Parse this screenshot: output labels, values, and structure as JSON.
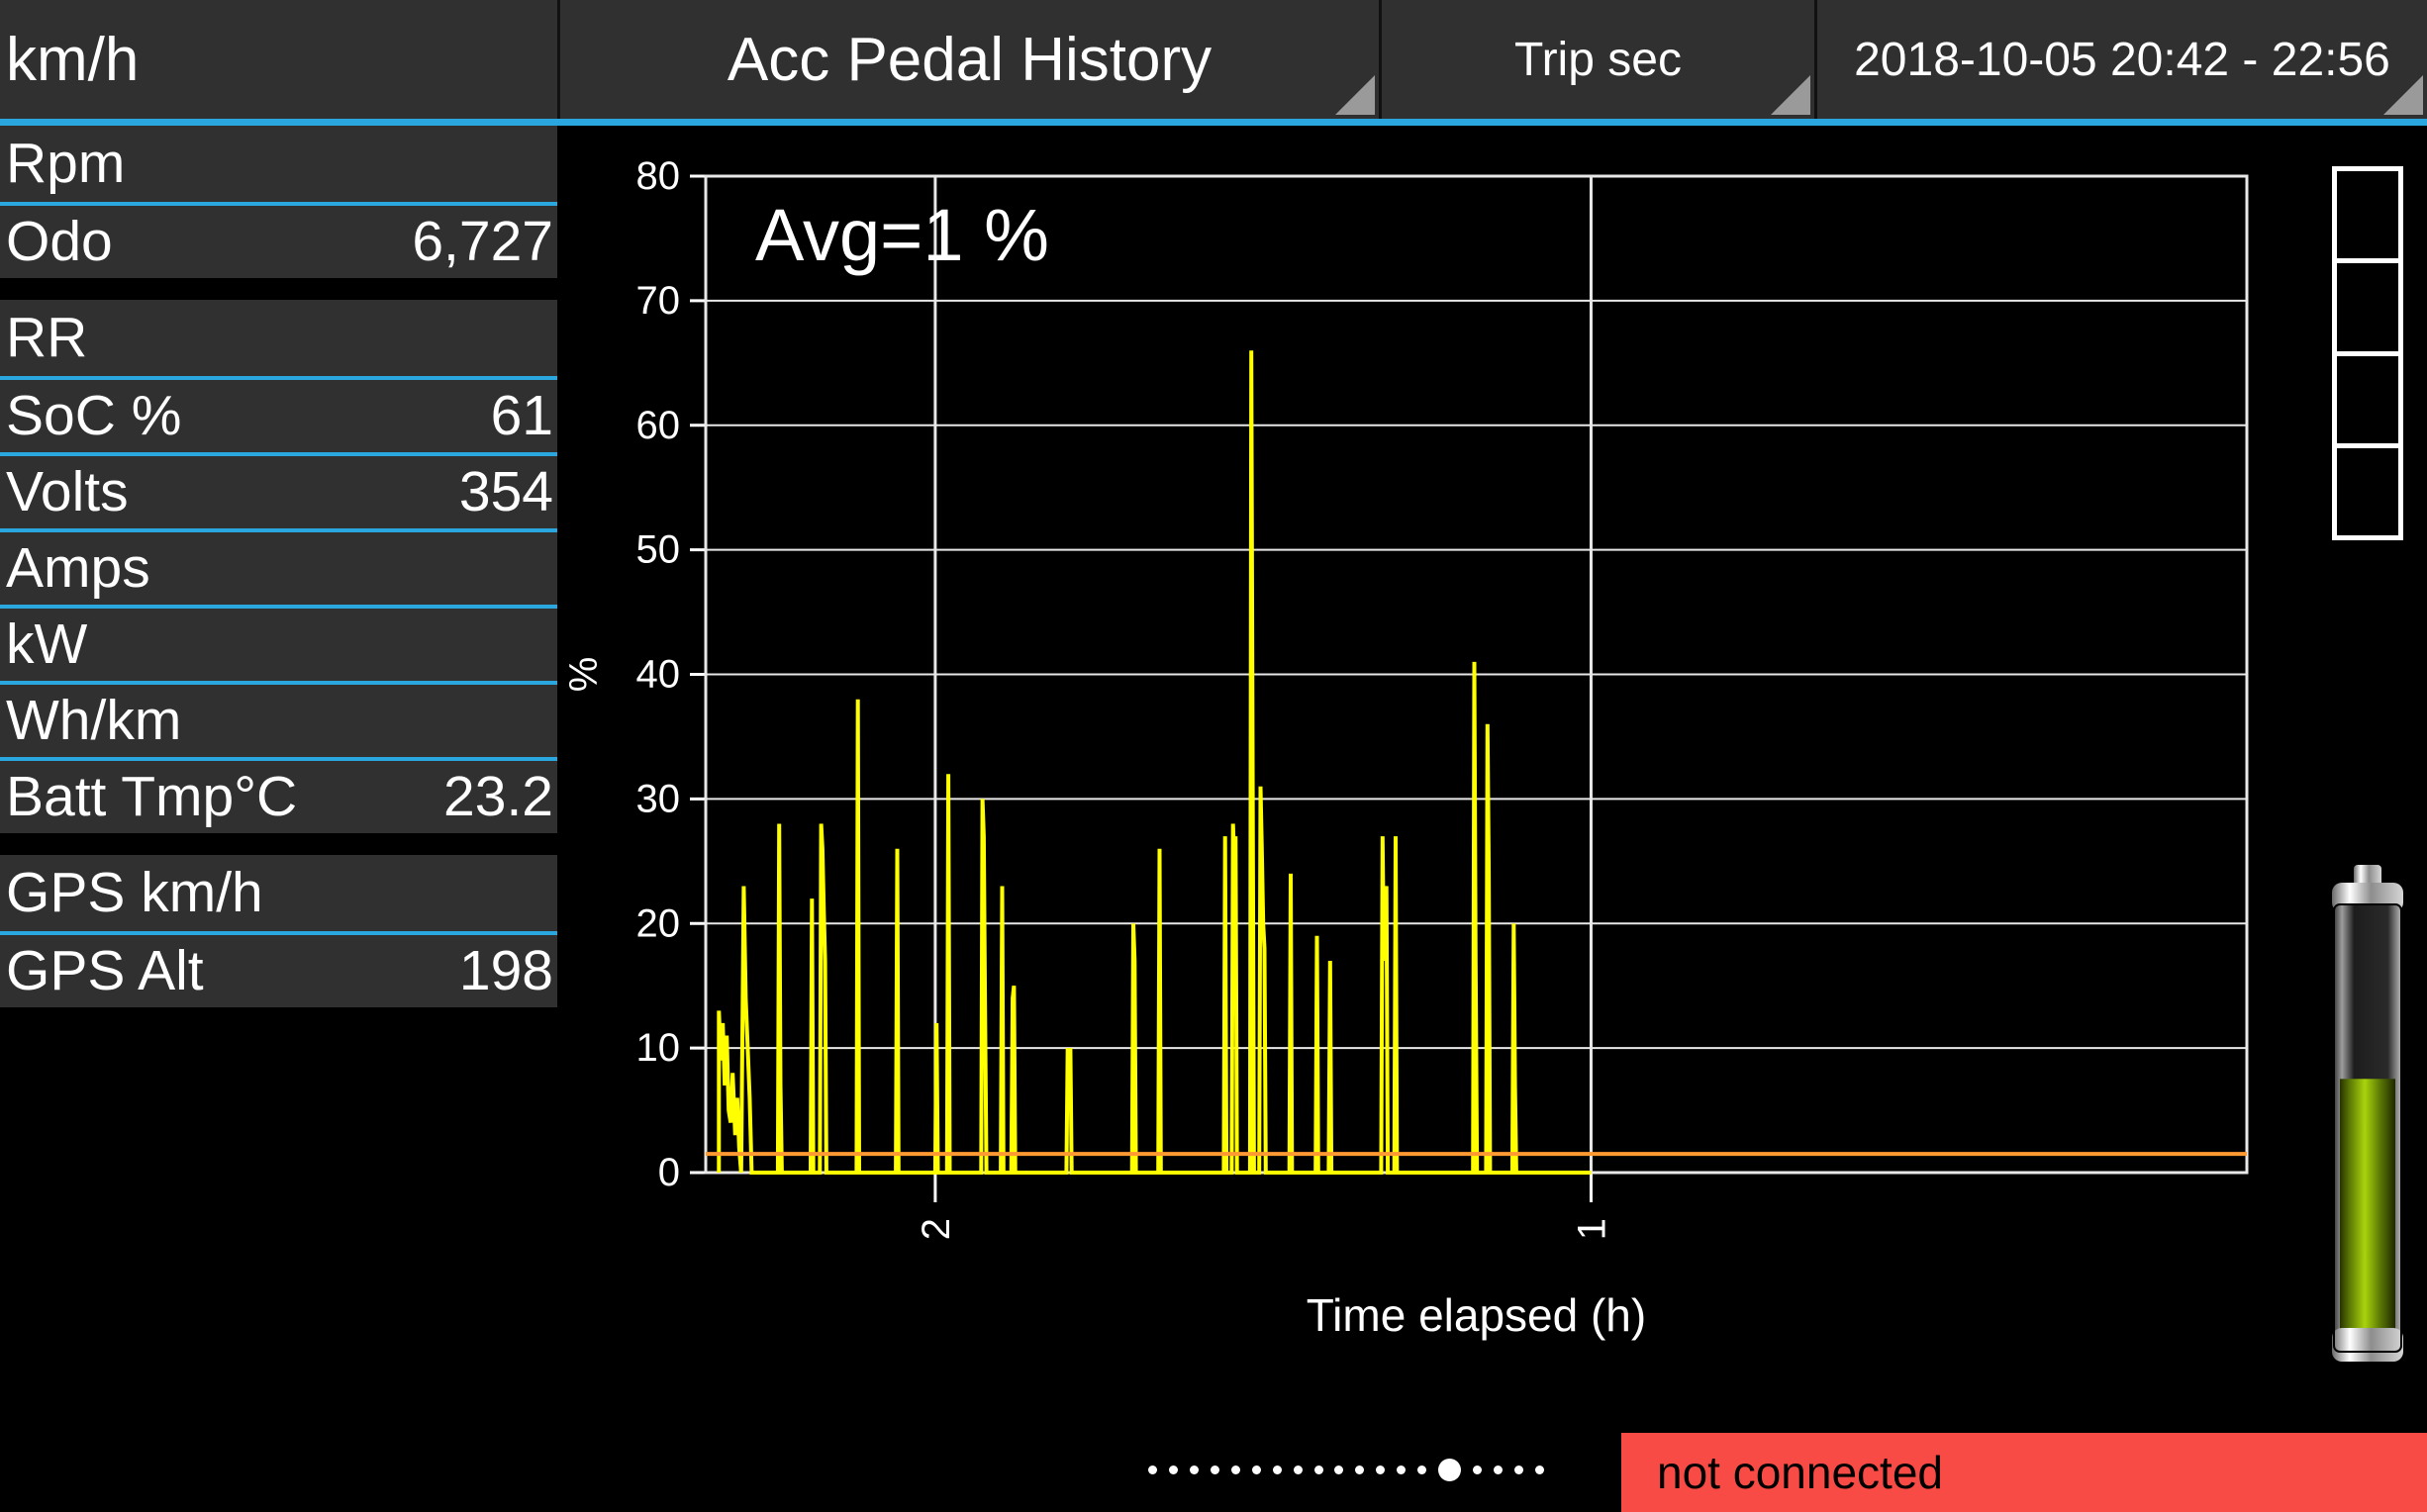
{
  "header": {
    "unit_label": "km/h",
    "title": "Acc Pedal History",
    "trip_tab": "Trip sec",
    "date_range": "2018-10-05 20:42 - 22:56",
    "underline_color": "#29a7de"
  },
  "sidebar": {
    "separator_color": "#29a7de",
    "groups": [
      {
        "rows": [
          {
            "label": "Rpm",
            "value": ""
          },
          {
            "label": "Odo",
            "value": "6,727"
          }
        ]
      },
      {
        "rows": [
          {
            "label": "RR",
            "value": ""
          },
          {
            "label": "SoC %",
            "value": "61"
          },
          {
            "label": "Volts",
            "value": "354"
          },
          {
            "label": "Amps",
            "value": ""
          },
          {
            "label": "kW",
            "value": ""
          },
          {
            "label": "Wh/km",
            "value": ""
          },
          {
            "label": "Batt Tmp°C",
            "value": "23.2"
          }
        ]
      },
      {
        "rows": [
          {
            "label": "GPS km/h",
            "value": ""
          },
          {
            "label": "GPS Alt",
            "value": "198"
          }
        ]
      }
    ]
  },
  "chart_data": {
    "type": "line",
    "title": "",
    "annotation": "Avg=1 %",
    "xlabel": "Time elapsed (h)",
    "ylabel": "%",
    "xlim": [
      2.35,
      0.0
    ],
    "ylim": [
      0,
      80
    ],
    "yticks": [
      0,
      10,
      20,
      30,
      40,
      50,
      60,
      70,
      80
    ],
    "xticks": [
      2,
      1
    ],
    "xtick_labels": [
      "2",
      "1"
    ],
    "grid": true,
    "series_color": "#ffff00",
    "average_line_color": "#ff9a33",
    "average_value": 1.5,
    "series": [
      {
        "name": "Acc Pedal",
        "points": [
          [
            2.33,
            0
          ],
          [
            2.33,
            13
          ],
          [
            2.327,
            9
          ],
          [
            2.324,
            12
          ],
          [
            2.321,
            7
          ],
          [
            2.318,
            11
          ],
          [
            2.315,
            5
          ],
          [
            2.312,
            4
          ],
          [
            2.309,
            8
          ],
          [
            2.305,
            3
          ],
          [
            2.302,
            6
          ],
          [
            2.299,
            2
          ],
          [
            2.296,
            0
          ],
          [
            2.292,
            23
          ],
          [
            2.289,
            14
          ],
          [
            2.286,
            10
          ],
          [
            2.283,
            6
          ],
          [
            2.28,
            0
          ],
          [
            2.24,
            0
          ],
          [
            2.238,
            28
          ],
          [
            2.236,
            7
          ],
          [
            2.234,
            0
          ],
          [
            2.19,
            0
          ],
          [
            2.188,
            22
          ],
          [
            2.186,
            0
          ],
          [
            2.176,
            0
          ],
          [
            2.174,
            28
          ],
          [
            2.172,
            26
          ],
          [
            2.17,
            21
          ],
          [
            2.168,
            17
          ],
          [
            2.166,
            0
          ],
          [
            2.12,
            0
          ],
          [
            2.118,
            38
          ],
          [
            2.116,
            0
          ],
          [
            2.06,
            0
          ],
          [
            2.058,
            26
          ],
          [
            2.056,
            0
          ],
          [
            2.0,
            0
          ],
          [
            1.998,
            12
          ],
          [
            1.996,
            0
          ],
          [
            1.982,
            0
          ],
          [
            1.98,
            32
          ],
          [
            1.978,
            0
          ],
          [
            1.93,
            0
          ],
          [
            1.928,
            30
          ],
          [
            1.926,
            27
          ],
          [
            1.924,
            13
          ],
          [
            1.922,
            0
          ],
          [
            1.9,
            0
          ],
          [
            1.898,
            23
          ],
          [
            1.896,
            0
          ],
          [
            1.884,
            0
          ],
          [
            1.882,
            14
          ],
          [
            1.88,
            15
          ],
          [
            1.878,
            0
          ],
          [
            1.8,
            0
          ],
          [
            1.798,
            10
          ],
          [
            1.796,
            7
          ],
          [
            1.794,
            10
          ],
          [
            1.792,
            0
          ],
          [
            1.7,
            0
          ],
          [
            1.698,
            20
          ],
          [
            1.696,
            17
          ],
          [
            1.694,
            0
          ],
          [
            1.66,
            0
          ],
          [
            1.658,
            26
          ],
          [
            1.656,
            0
          ],
          [
            1.56,
            0
          ],
          [
            1.558,
            27
          ],
          [
            1.556,
            0
          ],
          [
            1.548,
            0
          ],
          [
            1.546,
            28
          ],
          [
            1.544,
            25
          ],
          [
            1.542,
            27
          ],
          [
            1.54,
            0
          ],
          [
            1.52,
            0
          ],
          [
            1.518,
            66
          ],
          [
            1.516,
            31
          ],
          [
            1.514,
            0
          ],
          [
            1.506,
            0
          ],
          [
            1.504,
            31
          ],
          [
            1.502,
            26
          ],
          [
            1.5,
            20
          ],
          [
            1.498,
            18
          ],
          [
            1.496,
            0
          ],
          [
            1.46,
            0
          ],
          [
            1.458,
            24
          ],
          [
            1.456,
            0
          ],
          [
            1.42,
            0
          ],
          [
            1.418,
            19
          ],
          [
            1.416,
            0
          ],
          [
            1.4,
            0
          ],
          [
            1.398,
            17
          ],
          [
            1.396,
            0
          ],
          [
            1.32,
            0
          ],
          [
            1.318,
            27
          ],
          [
            1.316,
            17
          ],
          [
            1.314,
            22
          ],
          [
            1.312,
            23
          ],
          [
            1.31,
            0
          ],
          [
            1.3,
            0
          ],
          [
            1.298,
            27
          ],
          [
            1.296,
            0
          ],
          [
            1.18,
            0
          ],
          [
            1.178,
            41
          ],
          [
            1.176,
            17
          ],
          [
            1.174,
            0
          ],
          [
            1.16,
            0
          ],
          [
            1.158,
            36
          ],
          [
            1.156,
            24
          ],
          [
            1.154,
            0
          ],
          [
            1.12,
            0
          ],
          [
            1.118,
            20
          ],
          [
            1.116,
            7
          ],
          [
            1.114,
            0
          ],
          [
            1.0,
            0
          ]
        ]
      }
    ]
  },
  "gauge": {
    "segments": 4,
    "filled": 0
  },
  "battery": {
    "fill_percent": 61,
    "fill_color": "#7fa00a"
  },
  "page_dots": {
    "count": 19,
    "active_index": 14
  },
  "status": {
    "text": "not connected",
    "background": "#f94b45"
  }
}
